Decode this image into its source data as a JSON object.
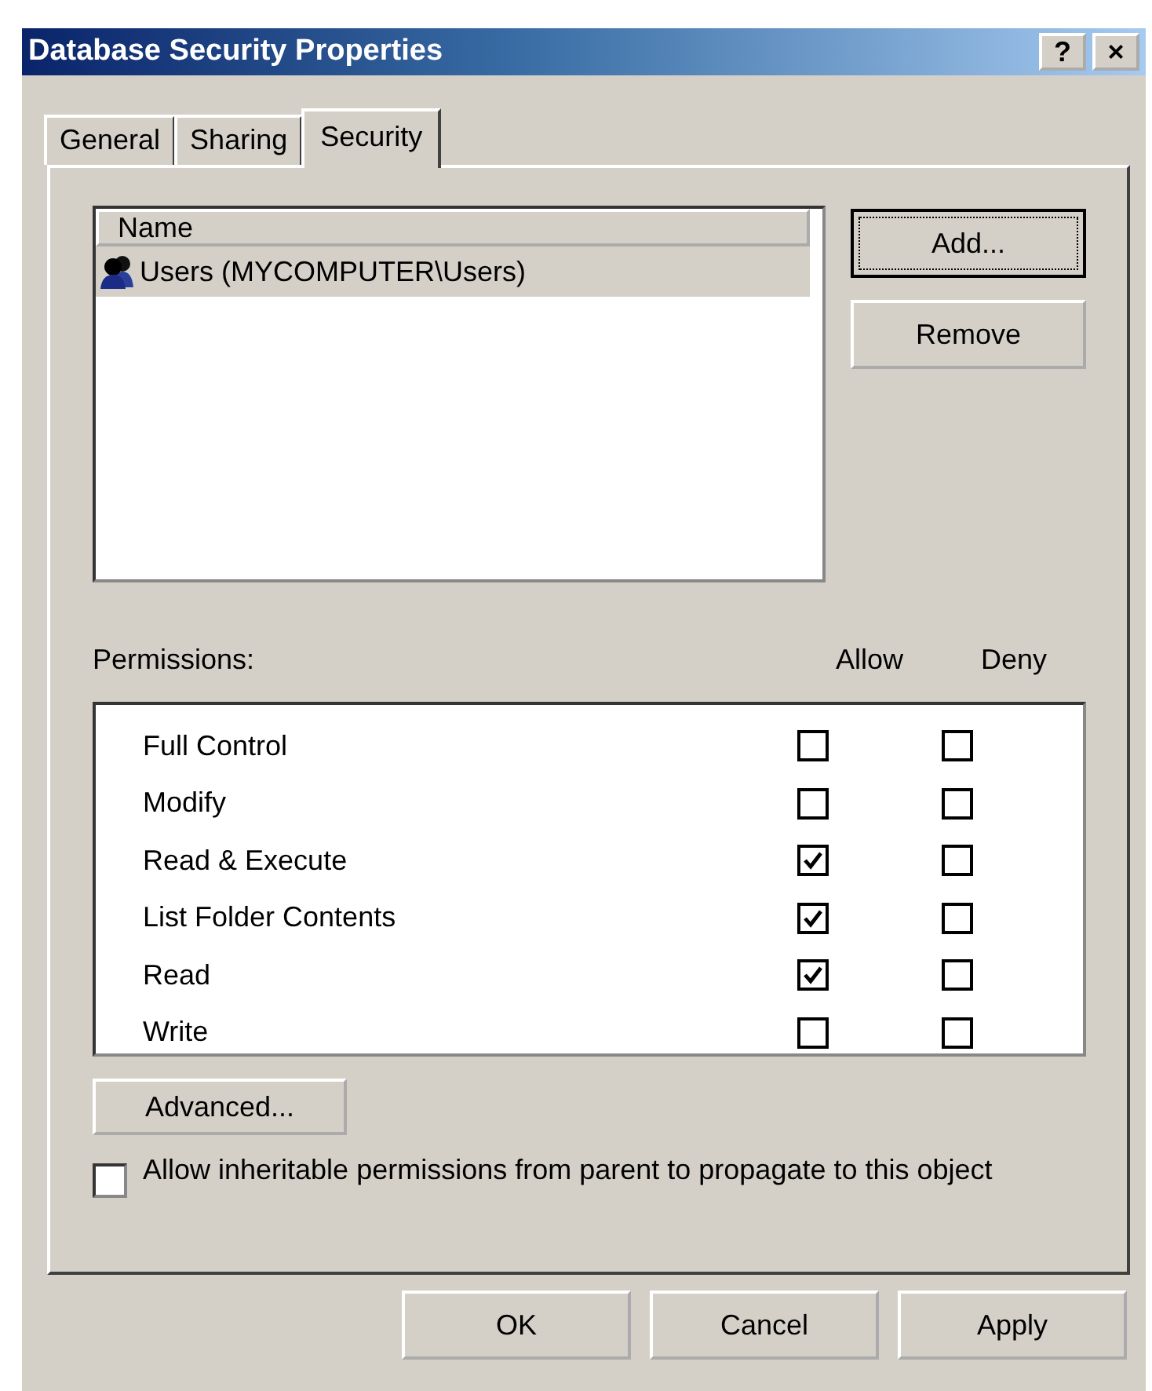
{
  "window": {
    "title": "Database Security Properties",
    "title_buttons": [
      "?",
      "×"
    ]
  },
  "tabs": [
    {
      "label": "General",
      "selected": false
    },
    {
      "label": "Sharing",
      "selected": false
    },
    {
      "label": "Security",
      "selected": true
    }
  ],
  "names": {
    "column": "Name",
    "items": [
      {
        "label": "Users (MYCOMPUTER\\Users)",
        "selected": true
      }
    ]
  },
  "name_buttons": [
    {
      "label": "Add...",
      "focused": true
    },
    {
      "label": "Remove",
      "focused": false
    }
  ],
  "permissions": {
    "label": "Permissions:",
    "columns": [
      "Allow",
      "Deny"
    ],
    "rows": [
      {
        "name": "Full Control",
        "allow": false,
        "deny": false
      },
      {
        "name": "Modify",
        "allow": false,
        "deny": false
      },
      {
        "name": "Read & Execute",
        "allow": true,
        "deny": false
      },
      {
        "name": "List Folder Contents",
        "allow": true,
        "deny": false
      },
      {
        "name": "Read",
        "allow": true,
        "deny": false
      },
      {
        "name": "Write",
        "allow": false,
        "deny": false
      }
    ]
  },
  "advanced_button": "Advanced...",
  "inherit": {
    "label": "Allow inheritable permissions from parent to propagate to this object",
    "checked": false
  },
  "buttons": [
    "OK",
    "Cancel",
    "Apply"
  ]
}
